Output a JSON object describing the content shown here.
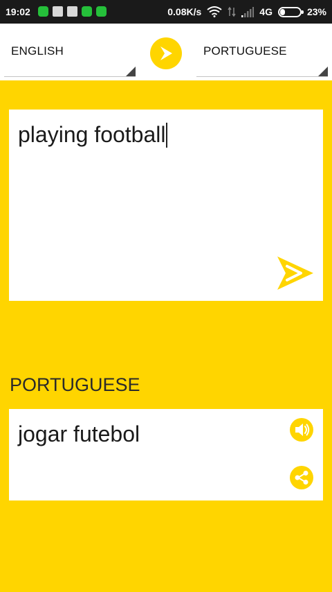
{
  "status_bar": {
    "time": "19:02",
    "speed": "0.08K/s",
    "network": "4G",
    "battery": "23%",
    "battery_level": 0.23,
    "notification_icons": [
      "whatsapp-icon",
      "screenshot-icon",
      "message-icon",
      "app-icon",
      "whatsapp-icon"
    ]
  },
  "language_bar": {
    "source_language": "ENGLISH",
    "target_language": "PORTUGUESE",
    "swap_icon": "arrow-right-icon"
  },
  "input": {
    "text": "playing football",
    "translate_icon": "send-arrow-icon"
  },
  "result": {
    "language_label": "PORTUGUESE",
    "text": "jogar futebol",
    "speak_icon": "speaker-icon",
    "share_icon": "share-icon"
  },
  "colors": {
    "accent": "#FFD500",
    "card": "#FFFFFF",
    "status_bar": "#1A1A1A"
  }
}
